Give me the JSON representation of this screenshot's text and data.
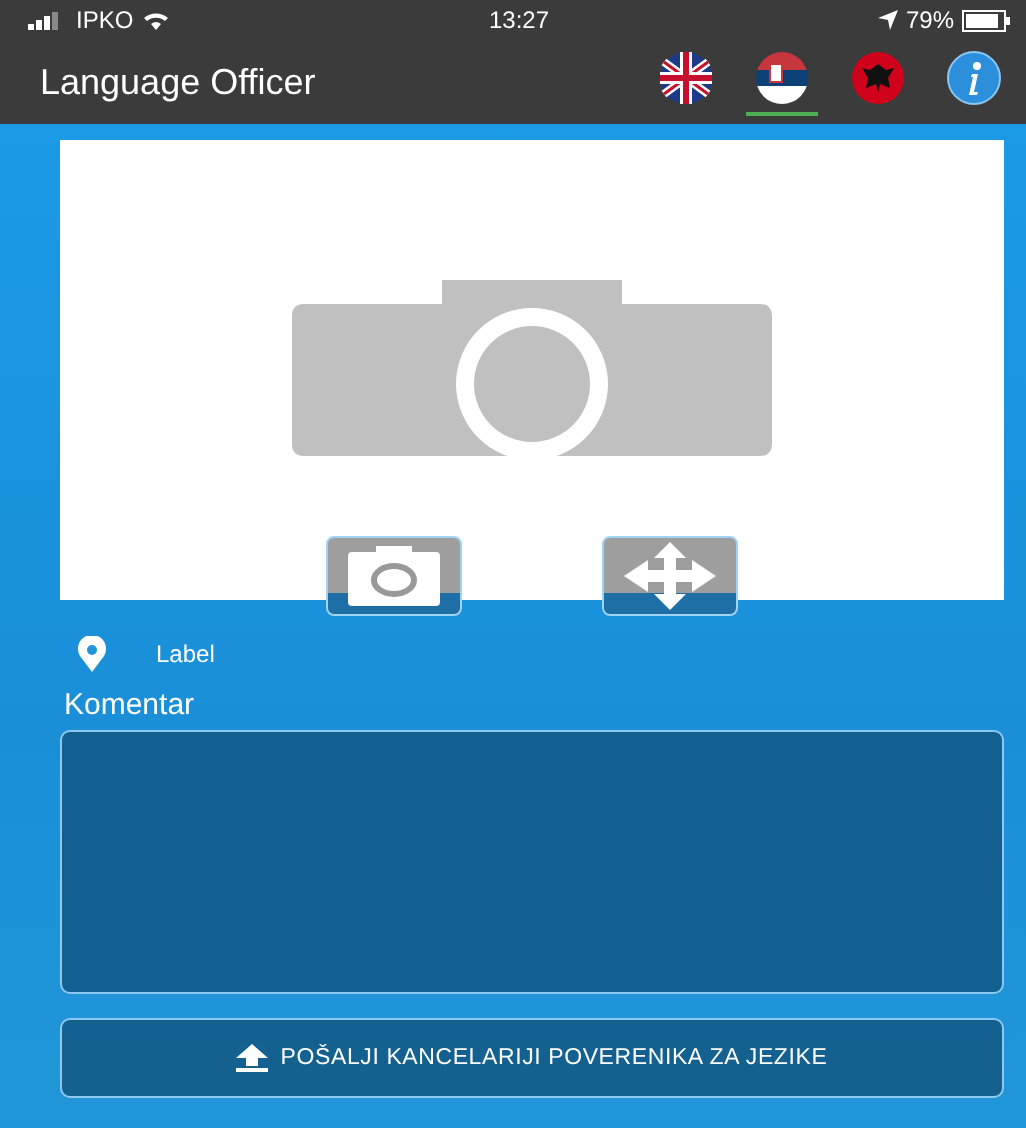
{
  "status_bar": {
    "carrier": "IPKO",
    "time": "13:27",
    "battery": "79%"
  },
  "nav": {
    "title": "Language Officer",
    "languages": [
      {
        "kind": "uk",
        "selected": false
      },
      {
        "kind": "rs",
        "selected": true
      },
      {
        "kind": "al",
        "selected": false
      },
      {
        "kind": "info",
        "selected": false
      }
    ]
  },
  "location": {
    "label": "Label"
  },
  "comment": {
    "label": "Komentar"
  },
  "send_button": {
    "label": "POŠALJI KANCELARIJI POVERENIKA ZA JEZIKE"
  }
}
